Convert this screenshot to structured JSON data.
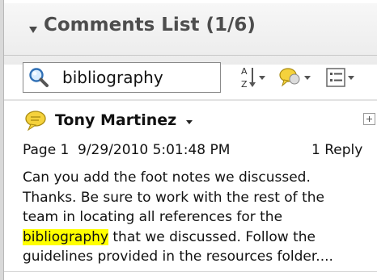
{
  "panel": {
    "title": "Comments List (1/6)"
  },
  "search": {
    "value": "bibliography",
    "placeholder": ""
  },
  "toolbar": {
    "icons": [
      "sort-icon",
      "comment-filter-icon",
      "options-icon"
    ]
  },
  "comment": {
    "author": "Tony Martinez",
    "page": "Page 1",
    "timestamp": "9/29/2010 5:01:48 PM",
    "replies": "1 Reply",
    "body_lines": [
      "Can you add the foot notes we discussed.",
      "Thanks. Be sure to work with the rest of the",
      "team in locating all references for the"
    ],
    "highlight_word": "bibliography",
    "line4_rest": " that we discussed. Follow the",
    "line5": "guidelines provided in the resources folder...."
  },
  "colors": {
    "highlight": "#ffff00",
    "comment_icon": "#f5d23c",
    "header_text": "#4d4d4d"
  }
}
